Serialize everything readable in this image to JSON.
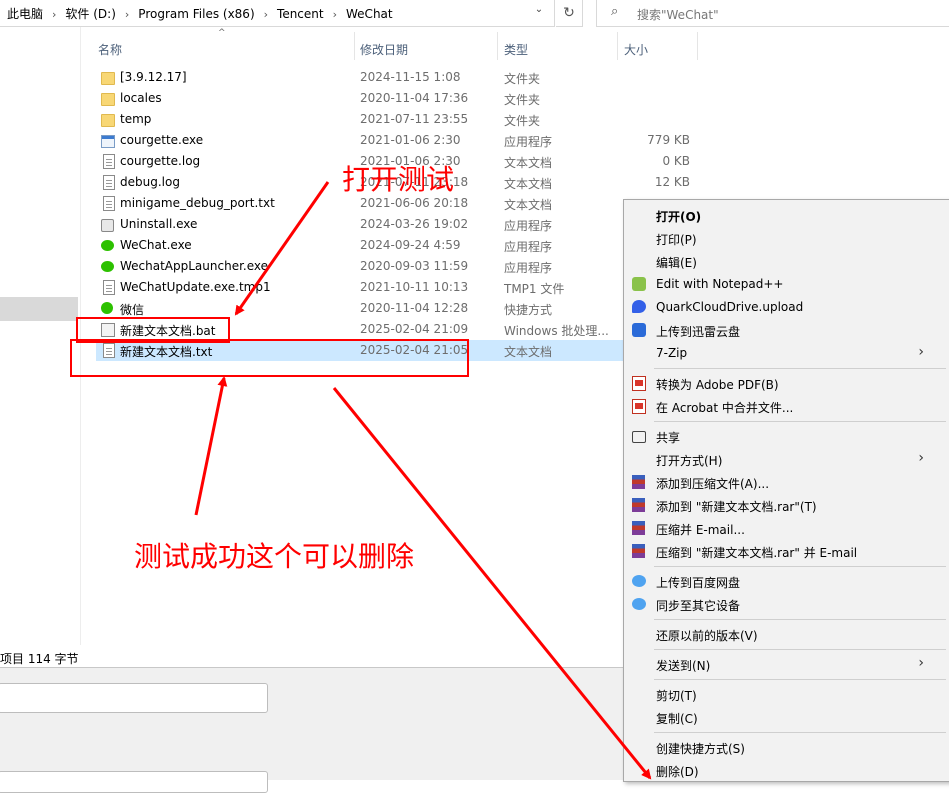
{
  "address_bar": {
    "crumbs": [
      "此电脑",
      "软件 (D:)",
      "Program Files (x86)",
      "Tencent",
      "WeChat"
    ],
    "dropdown_glyph": "⌄",
    "refresh_glyph": "↻"
  },
  "search": {
    "placeholder": "搜索\"WeChat\"",
    "icon": "search-icon"
  },
  "columns": {
    "name": "名称",
    "date": "修改日期",
    "type": "类型",
    "size": "大小"
  },
  "files": [
    {
      "name": "[3.9.12.17]",
      "date": "2024-11-15 1:08",
      "type": "文件夹",
      "size": "",
      "icon": "folder-icon"
    },
    {
      "name": "locales",
      "date": "2020-11-04 17:36",
      "type": "文件夹",
      "size": "",
      "icon": "folder-icon"
    },
    {
      "name": "temp",
      "date": "2021-07-11 23:55",
      "type": "文件夹",
      "size": "",
      "icon": "folder-icon"
    },
    {
      "name": "courgette.exe",
      "date": "2021-01-06 2:30",
      "type": "应用程序",
      "size": "779 KB",
      "icon": "exe-icon"
    },
    {
      "name": "courgette.log",
      "date": "2021-01-06 2:30",
      "type": "文本文档",
      "size": "0 KB",
      "icon": "text-file-icon"
    },
    {
      "name": "debug.log",
      "date": "2021-07-11 23:18",
      "type": "文本文档",
      "size": "12 KB",
      "icon": "text-file-icon"
    },
    {
      "name": "minigame_debug_port.txt",
      "date": "2021-06-06 20:18",
      "type": "文本文档",
      "size": "",
      "icon": "text-file-icon"
    },
    {
      "name": "Uninstall.exe",
      "date": "2024-03-26 19:02",
      "type": "应用程序",
      "size": "",
      "icon": "uninstall-icon"
    },
    {
      "name": "WeChat.exe",
      "date": "2024-09-24 4:59",
      "type": "应用程序",
      "size": "",
      "icon": "wechat-icon"
    },
    {
      "name": "WechatAppLauncher.exe",
      "date": "2020-09-03 11:59",
      "type": "应用程序",
      "size": "",
      "icon": "wechat-icon"
    },
    {
      "name": "WeChatUpdate.exe.tmp1",
      "date": "2021-10-11 10:13",
      "type": "TMP1 文件",
      "size": "",
      "icon": "text-file-icon"
    },
    {
      "name": "微信",
      "date": "2020-11-04 12:28",
      "type": "快捷方式",
      "size": "",
      "icon": "shortcut-icon"
    },
    {
      "name": "新建文本文档.bat",
      "date": "2025-02-04 21:09",
      "type": "Windows 批处理...",
      "size": "",
      "icon": "batch-file-icon"
    },
    {
      "name": "新建文本文档.txt",
      "date": "2025-02-04 21:05",
      "type": "文本文档",
      "size": "",
      "icon": "text-file-icon",
      "selected": true
    }
  ],
  "status": {
    "text": "项目  114 字节"
  },
  "context_menu": {
    "items": [
      {
        "label": "打开(O)",
        "bold": true,
        "icon": ""
      },
      {
        "label": "打印(P)",
        "icon": ""
      },
      {
        "label": "编辑(E)",
        "icon": ""
      },
      {
        "label": "Edit with Notepad++",
        "icon": "notepadpp-icon"
      },
      {
        "label": "QuarkCloudDrive.upload",
        "icon": "quark-icon"
      },
      {
        "label": "上传到迅雷云盘",
        "icon": "xunlei-icon"
      },
      {
        "label": "7-Zip",
        "icon": "",
        "submenu": true
      },
      {
        "sep": true
      },
      {
        "label": "转换为 Adobe PDF(B)",
        "icon": "pdf-icon"
      },
      {
        "label": "在 Acrobat 中合并文件...",
        "icon": "pdf-icon"
      },
      {
        "sep": true
      },
      {
        "label": "共享",
        "icon": "share-icon"
      },
      {
        "label": "打开方式(H)",
        "icon": "",
        "submenu": true
      },
      {
        "label": "添加到压缩文件(A)...",
        "icon": "winrar-icon"
      },
      {
        "label": "添加到 \"新建文本文档.rar\"(T)",
        "icon": "winrar-icon"
      },
      {
        "label": "压缩并 E-mail...",
        "icon": "winrar-icon"
      },
      {
        "label": "压缩到 \"新建文本文档.rar\" 并 E-mail",
        "icon": "winrar-icon"
      },
      {
        "sep": true
      },
      {
        "label": "上传到百度网盘",
        "icon": "baidu-icon"
      },
      {
        "label": "同步至其它设备",
        "icon": "baidu-icon"
      },
      {
        "sep": true
      },
      {
        "label": "还原以前的版本(V)",
        "icon": ""
      },
      {
        "sep": true
      },
      {
        "label": "发送到(N)",
        "icon": "",
        "submenu": true
      },
      {
        "sep": true
      },
      {
        "label": "剪切(T)",
        "icon": ""
      },
      {
        "label": "复制(C)",
        "icon": ""
      },
      {
        "sep": true
      },
      {
        "label": "创建快捷方式(S)",
        "icon": ""
      },
      {
        "label": "删除(D)",
        "icon": ""
      }
    ],
    "submenu_glyph": "›"
  },
  "annotations": {
    "open_test": "打开测试",
    "delete_note": "测试成功这个可以删除",
    "color": "#ff0000"
  },
  "colors": {
    "selection": "#cce8ff",
    "header_text": "#4c607a",
    "secondary_text": "#6d6d6d"
  }
}
